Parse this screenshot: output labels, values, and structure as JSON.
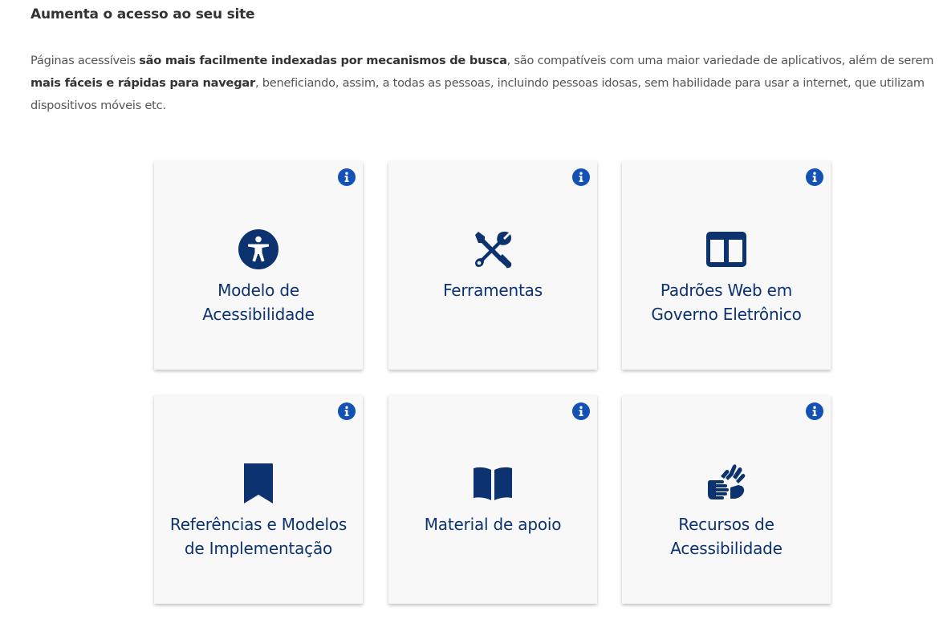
{
  "section": {
    "heading": "Aumenta o acesso ao seu site",
    "intro": {
      "p1": "Páginas acessíveis ",
      "b1": "são mais facilmente indexadas por mecanismos de busca",
      "p2": ", são compatíveis com uma maior variedade de aplicativos, além de serem ",
      "b2": "mais fáceis e rápidas para navegar",
      "p3": ", beneficiando, assim, a todas as pessoas, incluindo pessoas idosas, sem habilidade para usar a internet, que utilizam dispositivos móveis etc."
    }
  },
  "cards": [
    {
      "label": "Modelo de Acessibilidade",
      "icon": "universal-access-icon"
    },
    {
      "label": "Ferramentas",
      "icon": "tools-icon"
    },
    {
      "label": "Padrões Web em Governo Eletrônico",
      "icon": "columns-icon"
    },
    {
      "label": "Referências e Modelos de Implementação",
      "icon": "bookmark-icon"
    },
    {
      "label": "Material de apoio",
      "icon": "book-open-icon"
    },
    {
      "label": "Recursos de Acessibilidade",
      "icon": "sign-language-icon"
    }
  ],
  "colors": {
    "accent": "#0c326f",
    "info": "#1351b4",
    "card_bg": "#f8f8f8"
  }
}
